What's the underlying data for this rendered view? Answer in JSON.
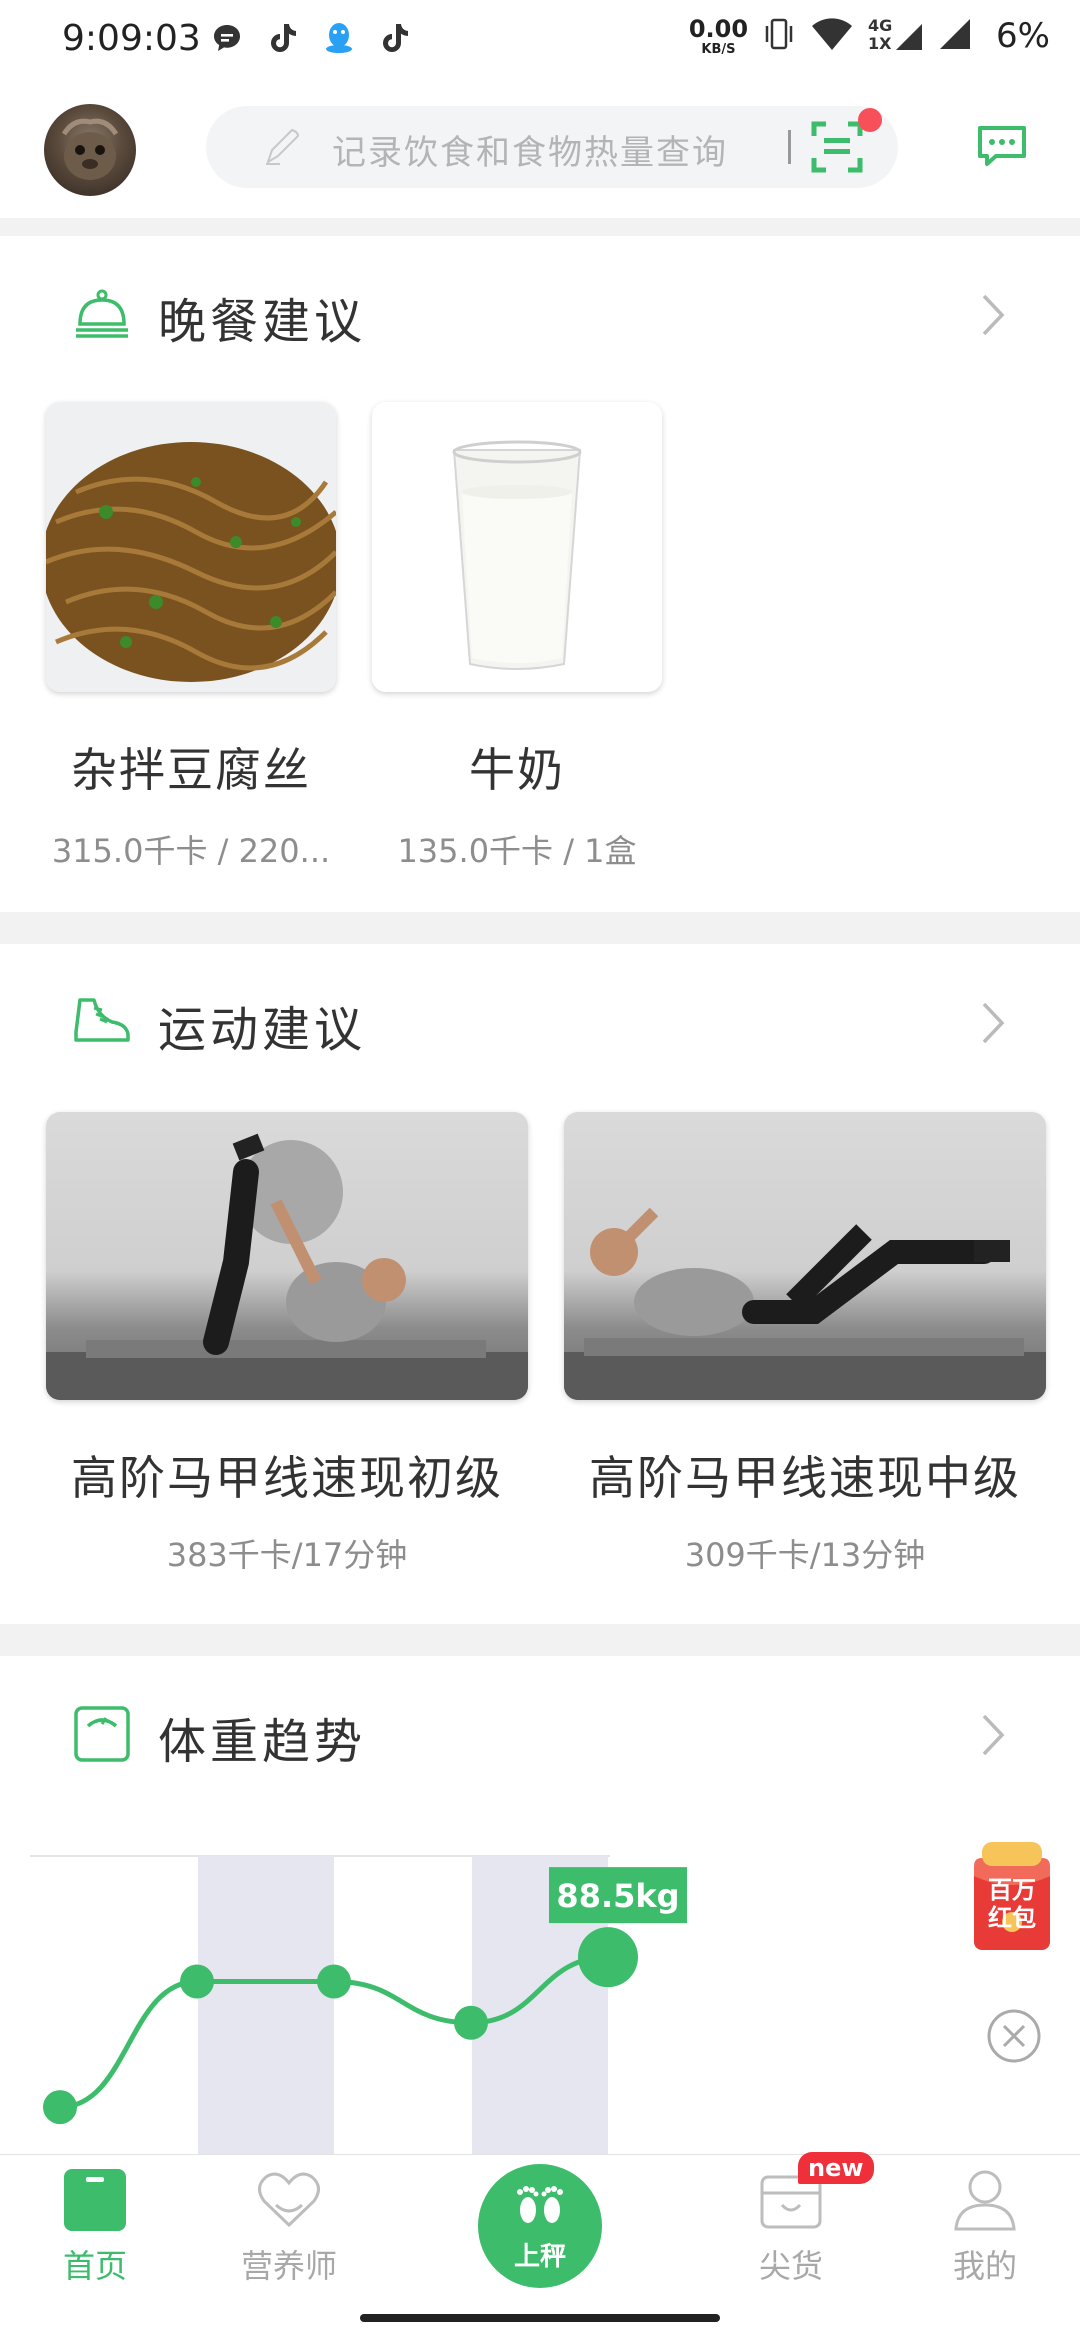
{
  "status_bar": {
    "time": "9:09:03",
    "net_speed_value": "0.00",
    "net_speed_unit": "KB/S",
    "network_type": "4G",
    "network_sub": "1X",
    "battery": "6%"
  },
  "header": {
    "search_placeholder": "记录饮食和食物热量查询"
  },
  "dinner": {
    "title": "晚餐建议",
    "items": [
      {
        "name": "杂拌豆腐丝",
        "calories": "315.0千卡 / 220..."
      },
      {
        "name": "牛奶",
        "calories": "135.0千卡 / 1盒"
      }
    ]
  },
  "exercise": {
    "title": "运动建议",
    "items": [
      {
        "name": "高阶马甲线速现初级",
        "calories": "383千卡/17分钟"
      },
      {
        "name": "高阶马甲线速现中级",
        "calories": "309千卡/13分钟"
      }
    ]
  },
  "weight": {
    "title": "体重趋势",
    "latest_label": "88.5kg",
    "promo_line1": "百万",
    "promo_line2": "红包"
  },
  "chart_data": {
    "type": "line",
    "series": [
      {
        "values": [
          80.5,
          87.2,
          87.2,
          85.0,
          88.5
        ]
      }
    ],
    "highlight_label": "88.5kg"
  },
  "nav": {
    "home": "首页",
    "nutritionist": "营养师",
    "scale": "上秤",
    "goods": "尖货",
    "mine": "我的",
    "new_badge": "new"
  },
  "colors": {
    "accent": "#3dbd6b",
    "badge_red": "#ef2f3a"
  }
}
